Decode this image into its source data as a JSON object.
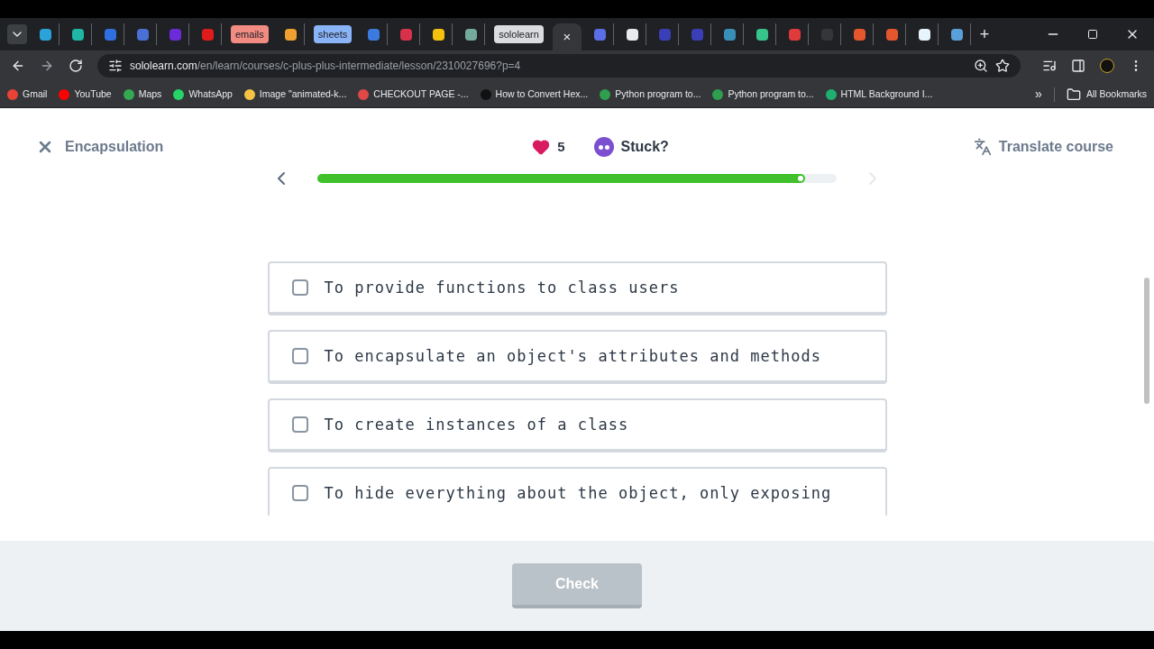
{
  "browser": {
    "tabs": [
      {
        "kind": "favicon",
        "color": "#2ba3d9",
        "selected": false
      },
      {
        "kind": "favicon",
        "color": "#1fb6a6",
        "selected": false
      },
      {
        "kind": "favicon",
        "color": "#2f6fe0",
        "selected": false
      },
      {
        "kind": "favicon",
        "color": "#4a6fd6",
        "selected": false
      },
      {
        "kind": "favicon",
        "color": "#6c2bd9",
        "selected": false
      },
      {
        "kind": "favicon",
        "color": "#e01b1b",
        "selected": false
      },
      {
        "kind": "group",
        "label": "emails",
        "color": "#f28b82",
        "selected": false
      },
      {
        "kind": "favicon",
        "color": "#f0a030",
        "selected": false
      },
      {
        "kind": "group",
        "label": "sheets",
        "color": "#8ab4f8",
        "selected": false
      },
      {
        "kind": "favicon",
        "color": "#3b7be0",
        "selected": false
      },
      {
        "kind": "favicon",
        "color": "#d8314a",
        "selected": false
      },
      {
        "kind": "favicon",
        "color": "#f4c20d",
        "selected": false
      },
      {
        "kind": "favicon",
        "color": "#74aa9c",
        "selected": false
      },
      {
        "kind": "group",
        "label": "sololearn",
        "color": "#dadce0",
        "selected": false
      },
      {
        "kind": "active",
        "close": "×",
        "selected": true
      },
      {
        "kind": "favicon",
        "color": "#5a6ee8",
        "selected": false
      },
      {
        "kind": "favicon",
        "color": "#e8eaed",
        "selected": false
      },
      {
        "kind": "favicon",
        "color": "#3a3fb8",
        "selected": false
      },
      {
        "kind": "favicon",
        "color": "#3a3fb8",
        "selected": false
      },
      {
        "kind": "favicon",
        "color": "#3a8fb8",
        "selected": false
      },
      {
        "kind": "favicon",
        "color": "#36c48a",
        "selected": false
      },
      {
        "kind": "favicon",
        "color": "#e03a3a",
        "selected": false
      },
      {
        "kind": "favicon",
        "color": "#35363a",
        "selected": false
      },
      {
        "kind": "favicon",
        "color": "#e4572e",
        "selected": false
      },
      {
        "kind": "favicon",
        "color": "#e4572e",
        "selected": false
      },
      {
        "kind": "favicon",
        "color": "#e8f4fc",
        "selected": false
      },
      {
        "kind": "favicon",
        "color": "#5aa0d8",
        "selected": false
      }
    ],
    "new_tab": "+",
    "url_host": "sololearn.com",
    "url_path": "/en/learn/courses/c-plus-plus-intermediate/lesson/2310027696?p=4",
    "bookmarks": [
      {
        "label": "Gmail",
        "color": "#ea4335"
      },
      {
        "label": "YouTube",
        "color": "#ff0000"
      },
      {
        "label": "Maps",
        "color": "#34a853"
      },
      {
        "label": "WhatsApp",
        "color": "#25d366"
      },
      {
        "label": "Image \"animated-k...",
        "color": "#f6c343"
      },
      {
        "label": "CHECKOUT PAGE -...",
        "color": "#e04848"
      },
      {
        "label": "How to Convert Hex...",
        "color": "#111111"
      },
      {
        "label": "Python program to...",
        "color": "#2e9e4f"
      },
      {
        "label": "Python program to...",
        "color": "#2e9e4f"
      },
      {
        "label": "HTML Background I...",
        "color": "#1fb06f"
      }
    ],
    "more": "»",
    "all_bookmarks": "All Bookmarks"
  },
  "lesson": {
    "title": "Encapsulation",
    "hearts": "5",
    "stuck": "Stuck?",
    "translate": "Translate course",
    "progress": {
      "level": 0.94
    },
    "options": [
      {
        "text": "To provide functions to class users",
        "checked": false
      },
      {
        "text": "To encapsulate an object's attributes and methods",
        "checked": false
      },
      {
        "text": "To create instances of a class",
        "checked": false
      },
      {
        "text": "To hide everything about the object, only exposing",
        "checked": false
      }
    ],
    "check_button": {
      "label": "Check",
      "disabled": true
    }
  }
}
